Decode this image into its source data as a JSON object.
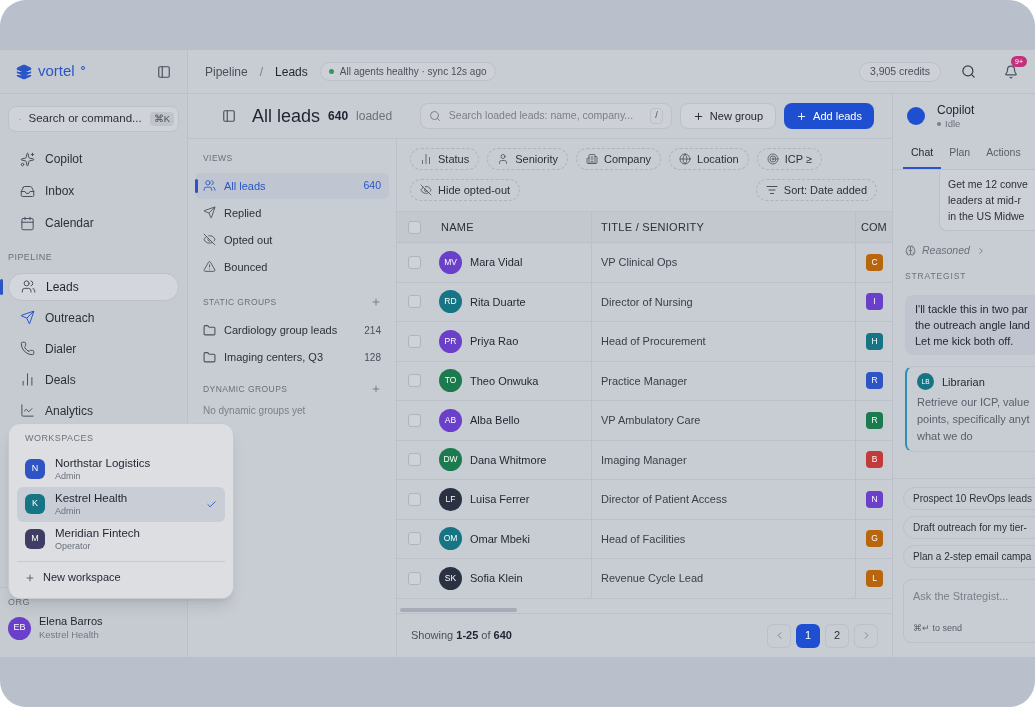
{
  "brand": {
    "name": "vortel"
  },
  "sidebar": {
    "search": {
      "placeholder": "Search or command...",
      "shortcut": "⌘K"
    },
    "items": [
      {
        "label": "Copilot",
        "selected": false
      },
      {
        "label": "Inbox",
        "selected": false
      },
      {
        "label": "Calendar",
        "selected": false
      }
    ],
    "section": "PIPELINE",
    "pipeline": [
      {
        "label": "Leads",
        "selected": true
      },
      {
        "label": "Outreach",
        "selected": false
      },
      {
        "label": "Dialer",
        "selected": false
      },
      {
        "label": "Deals",
        "selected": false
      },
      {
        "label": "Analytics",
        "selected": false
      }
    ],
    "org_label": "ORG",
    "user": {
      "initials": "EB",
      "name": "Elena Barros",
      "org": "Kestrel Health"
    }
  },
  "workspace_menu": {
    "title": "WORKSPACES",
    "items": [
      {
        "initial": "N",
        "name": "Northstar Logistics",
        "role": "Admin",
        "color": "#2f55c4",
        "selected": false
      },
      {
        "initial": "K",
        "name": "Kestrel Health",
        "role": "Admin",
        "color": "#167585",
        "selected": true
      },
      {
        "initial": "M",
        "name": "Meridian Fintech",
        "role": "Operator",
        "color": "#3f3d63",
        "selected": false
      }
    ],
    "new": "New workspace"
  },
  "topbar": {
    "breadcrumb": [
      "Pipeline",
      "Leads"
    ],
    "separator": "/",
    "status": "All agents healthy · sync 12s ago",
    "credits": "3,905 credits",
    "notifications": "9+"
  },
  "header": {
    "title": "All leads",
    "count": "640",
    "count_label": "loaded",
    "search": {
      "placeholder": "Search loaded leads: name, company...",
      "shortcut": "/"
    },
    "new_group": "New group",
    "add_leads": "Add leads"
  },
  "views": {
    "title": "VIEWS",
    "items": [
      {
        "label": "All leads",
        "count": "640",
        "selected": true
      },
      {
        "label": "Replied",
        "selected": false
      },
      {
        "label": "Opted out",
        "selected": false
      },
      {
        "label": "Bounced",
        "selected": false
      }
    ],
    "static_title": "STATIC GROUPS",
    "static": [
      {
        "label": "Cardiology group leads",
        "count": "214"
      },
      {
        "label": "Imaging centers, Q3",
        "count": "128"
      }
    ],
    "dynamic_title": "DYNAMIC GROUPS",
    "dynamic_empty": "No dynamic groups yet"
  },
  "filters": [
    "Status",
    "Seniority",
    "Company",
    "Location",
    "ICP ≥",
    "Hide opted-out"
  ],
  "sort": "Sort: Date added",
  "table": {
    "columns": [
      "NAME",
      "TITLE / SENIORITY",
      "COM"
    ],
    "select_all_checked": false,
    "rows": [
      {
        "initials": "MV",
        "name": "Mara Vidal",
        "color": "#6a3fc9",
        "title": "VP Clinical Ops",
        "company": {
          "initial": "C",
          "color": "#b8660e"
        },
        "checked": false
      },
      {
        "initials": "RD",
        "name": "Rita Duarte",
        "color": "#167585",
        "title": "Director of Nursing",
        "company": {
          "initial": "I",
          "color": "#6a3fc9"
        },
        "checked": false
      },
      {
        "initials": "PR",
        "name": "Priya Rao",
        "color": "#6a3fc9",
        "title": "Head of Procurement",
        "company": {
          "initial": "H",
          "color": "#167585"
        },
        "checked": false
      },
      {
        "initials": "TO",
        "name": "Theo Onwuka",
        "color": "#1b7a4e",
        "title": "Practice Manager",
        "company": {
          "initial": "R",
          "color": "#2f55c4"
        },
        "checked": false
      },
      {
        "initials": "AB",
        "name": "Alba Bello",
        "color": "#6a3fc9",
        "title": "VP Ambulatory Care",
        "company": {
          "initial": "R",
          "color": "#1b7a4e"
        },
        "checked": false
      },
      {
        "initials": "DW",
        "name": "Dana Whitmore",
        "color": "#1b7a4e",
        "title": "Imaging Manager",
        "company": {
          "initial": "B",
          "color": "#c23a3a"
        },
        "checked": false
      },
      {
        "initials": "LF",
        "name": "Luisa Ferrer",
        "color": "#2a3140",
        "title": "Director of Patient Access",
        "company": {
          "initial": "N",
          "color": "#6a3fc9"
        },
        "checked": false
      },
      {
        "initials": "OM",
        "name": "Omar Mbeki",
        "color": "#167585",
        "title": "Head of Facilities",
        "company": {
          "initial": "G",
          "color": "#b8660e"
        },
        "checked": false
      },
      {
        "initials": "SK",
        "name": "Sofia Klein",
        "color": "#2a3140",
        "title": "Revenue Cycle Lead",
        "company": {
          "initial": "L",
          "color": "#b8660e"
        },
        "checked": false
      }
    ]
  },
  "pagination": {
    "showing": "Showing",
    "range": "1-25",
    "of": "of",
    "total": "640",
    "pages": [
      {
        "label": "1",
        "selected": true
      },
      {
        "label": "2",
        "selected": false
      }
    ]
  },
  "copilot": {
    "title": "Copilot",
    "status": "Idle",
    "tabs": [
      {
        "label": "Chat",
        "selected": true
      },
      {
        "label": "Plan",
        "selected": false
      },
      {
        "label": "Actions",
        "selected": false
      }
    ],
    "user_message": [
      "Get me 12 conve",
      "leaders at mid-r",
      "in the US Midwe"
    ],
    "reasoned": "Reasoned",
    "agent_label": "STRATEGIST",
    "agent_message": [
      "I'll tackle this in two par",
      "the outreach angle land",
      "Let me kick both off."
    ],
    "delegate": {
      "initials": "LB",
      "name": "Librarian",
      "lines": [
        "Retrieve our ICP, value",
        "points, specifically anyt",
        "what we do"
      ]
    },
    "suggestions": [
      "Prospect 10 RevOps leads",
      "Draft outreach for my tier-",
      "Plan a 2-step email campa"
    ],
    "input": {
      "placeholder": "Ask the Strategist...",
      "hint": "⌘↵ to send"
    }
  }
}
